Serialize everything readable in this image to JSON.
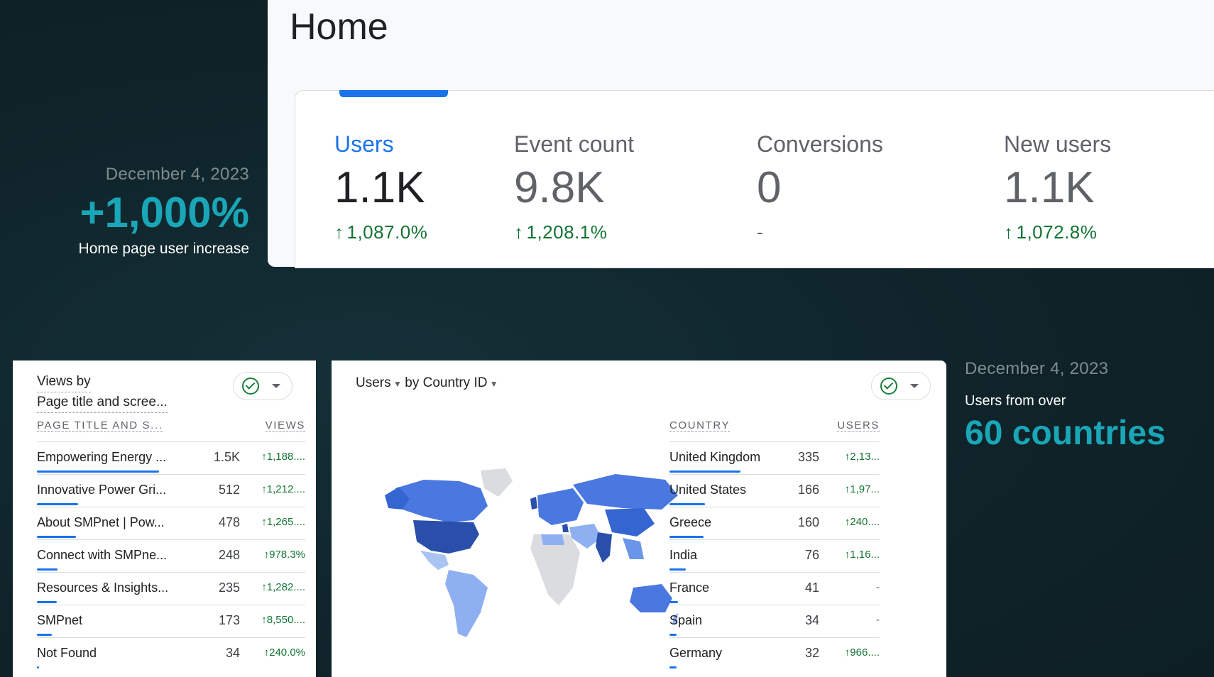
{
  "left_callout": {
    "date": "December 4, 2023",
    "headline": "+1,000%",
    "caption": "Home page user increase"
  },
  "home": {
    "title": "Home",
    "metrics": [
      {
        "label": "Users",
        "value": "1.1K",
        "change": "1,087.0%"
      },
      {
        "label": "Event count",
        "value": "9.8K",
        "change": "1,208.1%"
      },
      {
        "label": "Conversions",
        "value": "0",
        "change": "-"
      },
      {
        "label": "New users",
        "value": "1.1K",
        "change": "1,072.8%"
      }
    ]
  },
  "views_card": {
    "title_line1": "Views by",
    "title_line2": "Page title and scree...",
    "col_dimension": "PAGE TITLE AND S...",
    "col_metric": "VIEWS",
    "rows": [
      {
        "name": "Empowering Energy ...",
        "value": "1.5K",
        "change": "1,188....",
        "share": 1.0
      },
      {
        "name": "Innovative Power Gri...",
        "value": "512",
        "change": "1,212....",
        "share": 0.34
      },
      {
        "name": "About SMPnet | Pow...",
        "value": "478",
        "change": "1,265....",
        "share": 0.32
      },
      {
        "name": "Connect with SMPne...",
        "value": "248",
        "change": "978.3%",
        "share": 0.17
      },
      {
        "name": "Resources & Insights...",
        "value": "235",
        "change": "1,282....",
        "share": 0.16
      },
      {
        "name": "SMPnet",
        "value": "173",
        "change": "8,550....",
        "share": 0.12
      },
      {
        "name": "Not Found",
        "value": "34",
        "change": "240.0%",
        "share": 0.02
      }
    ]
  },
  "country_card": {
    "title_metric": "Users",
    "title_rest": "by Country ID",
    "col_dimension": "COUNTRY",
    "col_metric": "USERS",
    "rows": [
      {
        "name": "United Kingdom",
        "value": "335",
        "change": "2,13...",
        "share": 1.0
      },
      {
        "name": "United States",
        "value": "166",
        "change": "1,97...",
        "share": 0.5
      },
      {
        "name": "Greece",
        "value": "160",
        "change": "240....",
        "share": 0.48
      },
      {
        "name": "India",
        "value": "76",
        "change": "1,16...",
        "share": 0.23
      },
      {
        "name": "France",
        "value": "41",
        "change": "-",
        "share": 0.12
      },
      {
        "name": "Spain",
        "value": "34",
        "change": "-",
        "share": 0.1
      },
      {
        "name": "Germany",
        "value": "32",
        "change": "966....",
        "share": 0.1
      }
    ]
  },
  "right_callout": {
    "date": "December 4, 2023",
    "caption": "Users from over",
    "headline": "60 countries"
  },
  "colors": {
    "accent_teal": "#1aa6b7",
    "google_blue": "#1a73e8",
    "positive_green": "#137333",
    "background": "#0f2329"
  }
}
